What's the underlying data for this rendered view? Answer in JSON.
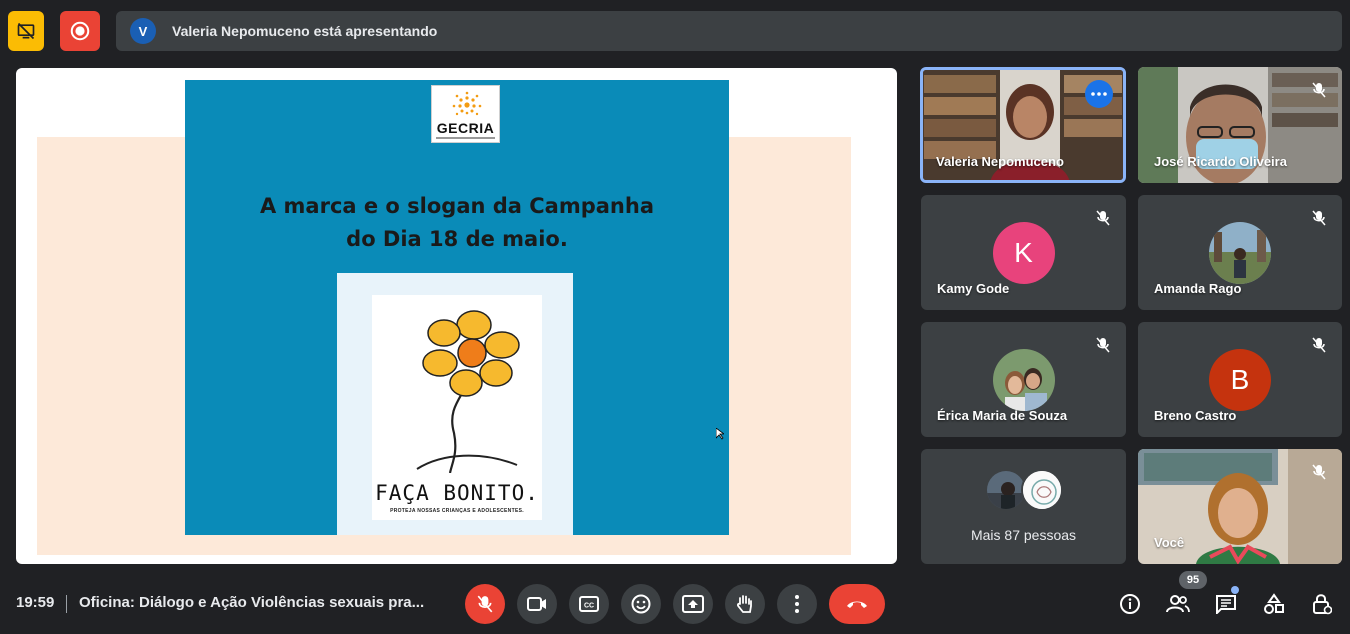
{
  "top_bar": {
    "presenter_initial": "V",
    "presenting_text": "Valeria Nepomuceno está apresentando"
  },
  "slide": {
    "logo_text": "GECRIA",
    "title_line1": "A marca e o slogan da Campanha",
    "title_line2": "do Dia 18 de maio.",
    "campaign_name": "FAÇA BONITO.",
    "campaign_tagline": "PROTEJA NOSSAS CRIANÇAS E ADOLESCENTES."
  },
  "participants": [
    {
      "name": "Valeria Nepomuceno",
      "type": "video",
      "speaking": true
    },
    {
      "name": "José Ricardo Oliveira",
      "type": "video",
      "muted": true
    },
    {
      "name": "Kamy Gode",
      "type": "initial",
      "initial": "K",
      "color": "#e8437c",
      "muted": true
    },
    {
      "name": "Amanda Rago",
      "type": "photo",
      "muted": true
    },
    {
      "name": "Érica Maria de Souza",
      "type": "photo",
      "muted": true
    },
    {
      "name": "Breno Castro",
      "type": "initial",
      "initial": "B",
      "color": "#c5330e",
      "muted": true
    },
    {
      "more_label": "Mais 87 pessoas"
    },
    {
      "name": "Você",
      "type": "video",
      "muted": true
    }
  ],
  "bottom_bar": {
    "time": "19:59",
    "meeting_title": "Oficina: Diálogo e Ação Violências sexuais pra...",
    "participant_count": "95"
  },
  "icons": {
    "present_off": "present-off-icon",
    "record": "record-icon",
    "mic_off": "mic-off-icon",
    "camera": "camera-icon",
    "captions": "captions-icon",
    "emoji": "emoji-icon",
    "present": "present-icon",
    "hand": "raise-hand-icon",
    "more": "more-vert-icon",
    "hangup": "hangup-icon",
    "info": "info-icon",
    "people": "people-icon",
    "chat": "chat-icon",
    "activities": "activities-icon",
    "host_controls": "host-controls-icon"
  },
  "colors": {
    "background": "#202124",
    "tile": "#3c4043",
    "danger": "#ea4335",
    "accent": "#8ab4f8",
    "slide_blue": "#0a8bb8"
  }
}
